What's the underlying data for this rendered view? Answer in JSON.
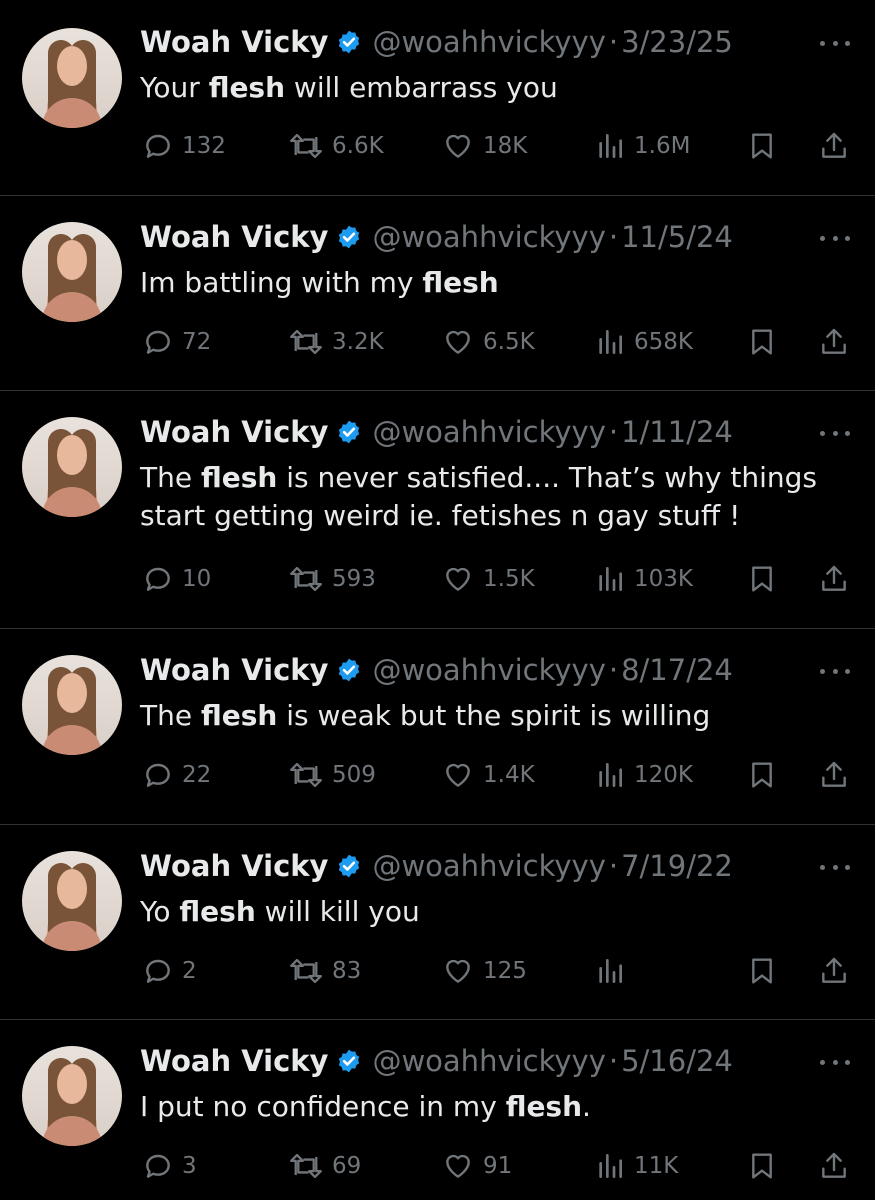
{
  "colors": {
    "background": "#000000",
    "text": "#e7e9ea",
    "secondary": "#71767b",
    "verified": "#1d9bf0",
    "divider": "#2f3336"
  },
  "icons": {
    "reply": "speech-bubble-icon",
    "retweet": "retweet-arrows-icon",
    "like": "heart-icon",
    "views": "bar-chart-icon",
    "bookmark": "bookmark-icon",
    "share": "share-upload-icon",
    "more": "more-dots-icon",
    "verified": "verified-badge-icon"
  },
  "tweets": [
    {
      "name": "Woah Vicky",
      "handle": "@woahhvickyyy",
      "dot": "·",
      "date": "3/23/25",
      "parts": [
        {
          "t": "Your "
        },
        {
          "t": "flesh",
          "b": true
        },
        {
          "t": " will embarrass you"
        }
      ],
      "replies": "132",
      "retweets": "6.6K",
      "likes": "18K",
      "views": "1.6M"
    },
    {
      "name": "Woah Vicky",
      "handle": "@woahhvickyyy",
      "dot": "·",
      "date": "11/5/24",
      "parts": [
        {
          "t": "Im battling with my "
        },
        {
          "t": "flesh",
          "b": true
        }
      ],
      "replies": "72",
      "retweets": "3.2K",
      "likes": "6.5K",
      "views": "658K"
    },
    {
      "name": "Woah Vicky",
      "handle": "@woahhvickyyy",
      "dot": "·",
      "date": "1/11/24",
      "parts": [
        {
          "t": "The "
        },
        {
          "t": "flesh",
          "b": true
        },
        {
          "t": " is never satisfied.... That’s why things start getting weird ie. fetishes n gay stuff !"
        }
      ],
      "replies": "10",
      "retweets": "593",
      "likes": "1.5K",
      "views": "103K"
    },
    {
      "name": "Woah Vicky",
      "handle": "@woahhvickyyy",
      "dot": "·",
      "date": "8/17/24",
      "parts": [
        {
          "t": "The "
        },
        {
          "t": "flesh",
          "b": true
        },
        {
          "t": " is weak but the spirit is willing"
        }
      ],
      "replies": "22",
      "retweets": "509",
      "likes": "1.4K",
      "views": "120K"
    },
    {
      "name": "Woah Vicky",
      "handle": "@woahhvickyyy",
      "dot": "·",
      "date": "7/19/22",
      "parts": [
        {
          "t": "Yo "
        },
        {
          "t": "flesh",
          "b": true
        },
        {
          "t": " will kill you"
        }
      ],
      "replies": "2",
      "retweets": "83",
      "likes": "125",
      "views": ""
    },
    {
      "name": "Woah Vicky",
      "handle": "@woahhvickyyy",
      "dot": "·",
      "date": "5/16/24",
      "parts": [
        {
          "t": "I put no confidence in my "
        },
        {
          "t": "flesh",
          "b": true
        },
        {
          "t": "."
        }
      ],
      "replies": "3",
      "retweets": "69",
      "likes": "91",
      "views": "11K"
    }
  ]
}
